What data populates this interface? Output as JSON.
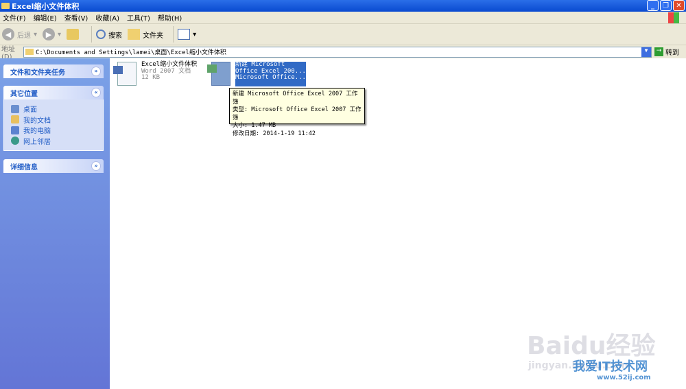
{
  "window": {
    "title": "Excel缩小文件体积"
  },
  "menu": [
    "文件(F)",
    "编辑(E)",
    "查看(V)",
    "收藏(A)",
    "工具(T)",
    "帮助(H)"
  ],
  "toolbar": {
    "back": "后退",
    "search": "搜索",
    "folders": "文件夹"
  },
  "address": {
    "label": "地址(D)",
    "value": "C:\\Documents and Settings\\lamei\\桌面\\Excel缩小文件体积",
    "go": "转到"
  },
  "sidebar": {
    "tasks": "文件和文件夹任务",
    "other": "其它位置",
    "places": [
      "桌面",
      "我的文档",
      "我的电脑",
      "网上邻居"
    ],
    "details": "详细信息"
  },
  "files": [
    {
      "name": "Excel缩小文件体积",
      "type": "Word 2007 文档",
      "size": "12 KB"
    },
    {
      "line1": "新建 Microsoft",
      "line2": "Office Excel 200...",
      "line3": "Microsoft Office..."
    }
  ],
  "tooltip": [
    "新建 Microsoft Office Excel 2007 工作簿",
    "类型: Microsoft Office Excel 2007 工作簿",
    "大小: 1.47 MB",
    "修改日期: 2014-1-19 11:42"
  ],
  "watermark": {
    "brand": "Baidu经验",
    "url": "jingyan.baidu.com",
    "site": "我爱IT技术网",
    "site_url": "www.52ij.com"
  }
}
